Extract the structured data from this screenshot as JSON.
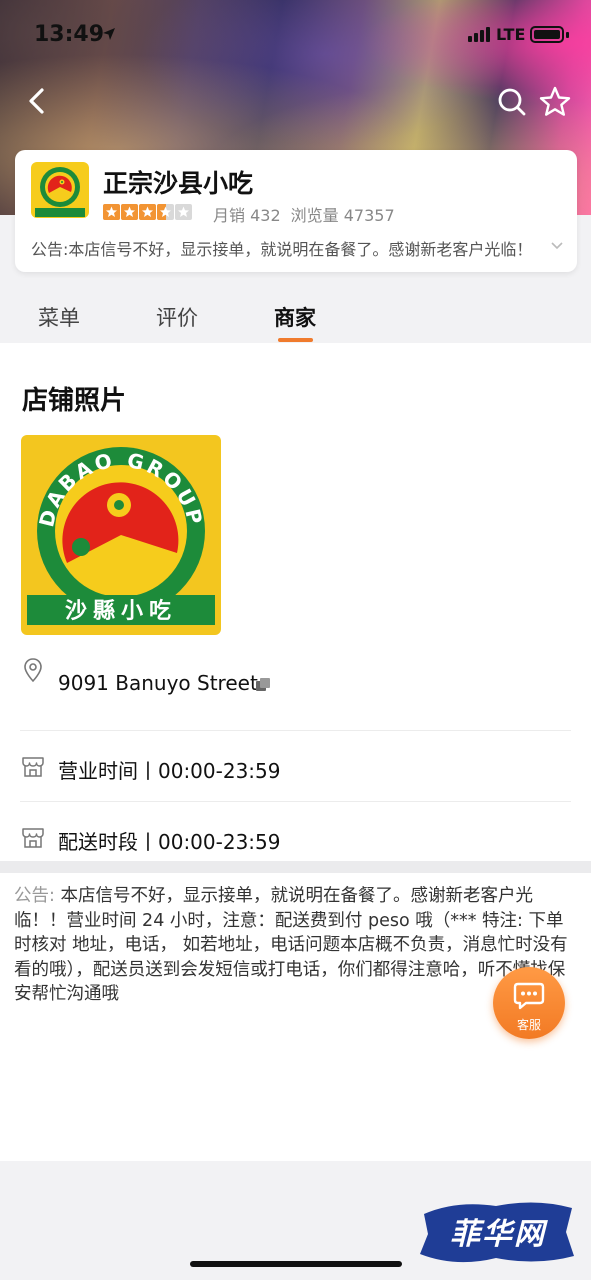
{
  "status_bar": {
    "time": "13:49",
    "network": "LTE"
  },
  "header": {
    "back": "back",
    "search": "search",
    "favorite": "favorite"
  },
  "store": {
    "name": "正宗沙县小吃",
    "rating_stars": 3.5,
    "monthly_sales": "月销 432",
    "views": "浏览量 47357",
    "notice_preview": "公告:本店信号不好，显示接单，就说明在备餐了。感谢新老客户光临！",
    "logo_top_text": "DABAO GROUP",
    "logo_bottom_text": "沙縣小吃"
  },
  "tabs": [
    {
      "label": "菜单",
      "active": false
    },
    {
      "label": "评价",
      "active": false
    },
    {
      "label": "商家",
      "active": true
    }
  ],
  "merchant": {
    "photos_title": "店铺照片",
    "address": "9091 Banuyo Street",
    "business_hours": "营业时间丨00:00-23:59",
    "delivery_hours": "配送时段丨00:00-23:59"
  },
  "announcement": {
    "label": "公告:",
    "text": " 本店信号不好，显示接单，就说明在备餐了。感谢新老客户光临！！营业时间 24 小时，注意：配送费到付 peso 哦（*** 特注: 下单时核对 地址，电话， 如若地址，电话问题本店概不负责，消息忙时没有看的哦），配送员送到会发短信或打电话，你们都得注意哈，听不懂找保安帮忙沟通哦"
  },
  "service_button": {
    "label": "客服"
  },
  "watermark": {
    "text": "菲华网"
  },
  "colors": {
    "accent": "#f07b2d",
    "star": "#f29433",
    "logo_green": "#1d8b3a",
    "logo_red": "#e2231a",
    "logo_yellow": "#f6cc1c"
  }
}
